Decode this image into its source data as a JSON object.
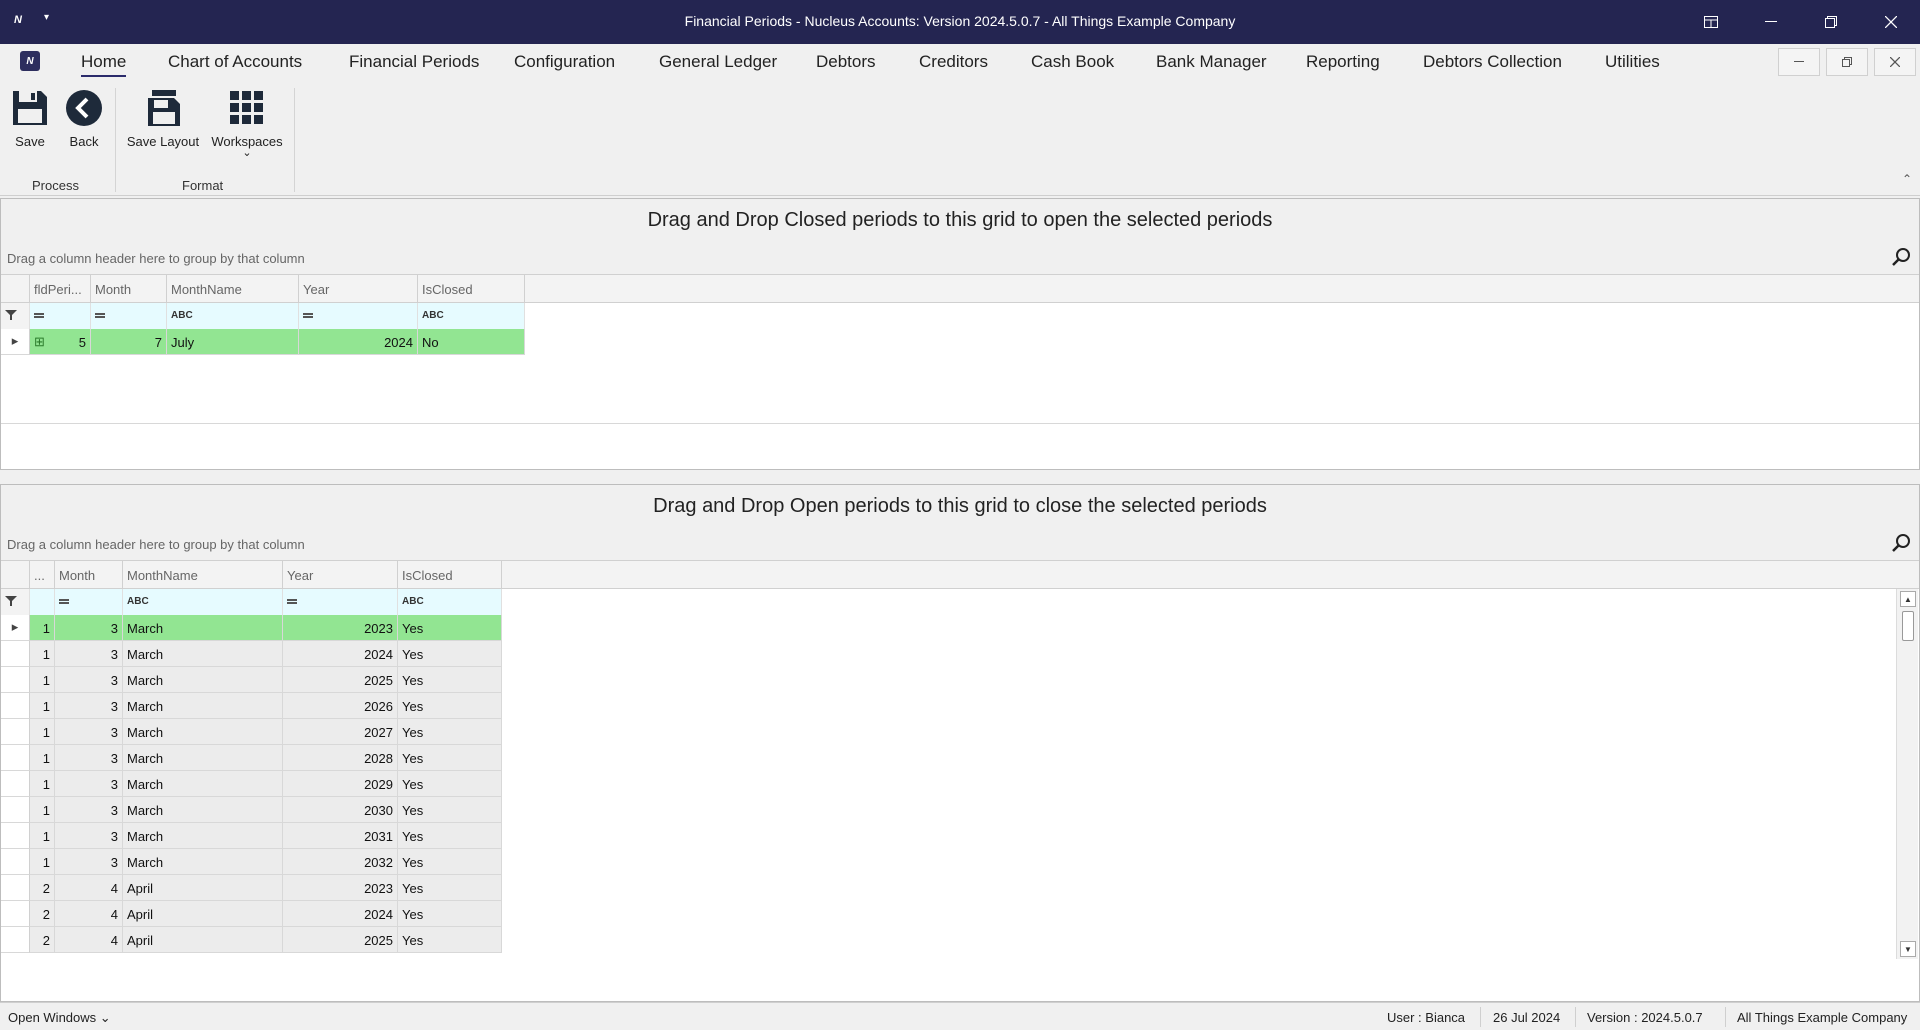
{
  "window": {
    "title": "Financial Periods - Nucleus Accounts: Version 2024.5.0.7 - All Things Example Company",
    "app_icon": "N",
    "quick_access_glyph": "▾"
  },
  "menu": {
    "tabs": [
      "Home",
      "Chart of Accounts",
      "Financial Periods",
      "Configuration",
      "General Ledger",
      "Debtors",
      "Creditors",
      "Cash Book",
      "Bank Manager",
      "Reporting",
      "Debtors Collection",
      "Utilities"
    ],
    "active_tab": "Home"
  },
  "ribbon": {
    "groups": [
      {
        "label": "Process",
        "buttons": [
          "Save",
          "Back"
        ]
      },
      {
        "label": "Format",
        "buttons": [
          "Save Layout",
          "Workspaces"
        ]
      }
    ],
    "workspaces_dropdown_glyph": "⌄",
    "collapse_glyph": "⌃"
  },
  "closed_panel": {
    "title": "Drag and Drop Closed periods to this grid to open the selected periods",
    "group_hint": "Drag a column header here to group by that column",
    "columns": [
      "fldPeri...",
      "Month",
      "MonthName",
      "Year",
      "IsClosed"
    ],
    "filter_glyphs": [
      "=",
      "=",
      "ABC",
      "=",
      "ABC"
    ],
    "rows": [
      {
        "expand": "⊞",
        "period": "5",
        "month": "7",
        "month_name": "July",
        "year": "2024",
        "is_closed": "No",
        "selected": true
      }
    ]
  },
  "open_panel": {
    "title": "Drag and Drop Open periods to this grid to close the selected periods",
    "group_hint": "Drag a column header here to group by that column",
    "columns": [
      "...",
      "Month",
      "MonthName",
      "Year",
      "IsClosed"
    ],
    "rows": [
      {
        "period": "1",
        "month": "3",
        "month_name": "March",
        "year": "2023",
        "is_closed": "Yes",
        "selected": true
      },
      {
        "period": "1",
        "month": "3",
        "month_name": "March",
        "year": "2024",
        "is_closed": "Yes"
      },
      {
        "period": "1",
        "month": "3",
        "month_name": "March",
        "year": "2025",
        "is_closed": "Yes"
      },
      {
        "period": "1",
        "month": "3",
        "month_name": "March",
        "year": "2026",
        "is_closed": "Yes"
      },
      {
        "period": "1",
        "month": "3",
        "month_name": "March",
        "year": "2027",
        "is_closed": "Yes"
      },
      {
        "period": "1",
        "month": "3",
        "month_name": "March",
        "year": "2028",
        "is_closed": "Yes"
      },
      {
        "period": "1",
        "month": "3",
        "month_name": "March",
        "year": "2029",
        "is_closed": "Yes"
      },
      {
        "period": "1",
        "month": "3",
        "month_name": "March",
        "year": "2030",
        "is_closed": "Yes"
      },
      {
        "period": "1",
        "month": "3",
        "month_name": "March",
        "year": "2031",
        "is_closed": "Yes"
      },
      {
        "period": "1",
        "month": "3",
        "month_name": "March",
        "year": "2032",
        "is_closed": "Yes"
      },
      {
        "period": "2",
        "month": "4",
        "month_name": "April",
        "year": "2023",
        "is_closed": "Yes"
      },
      {
        "period": "2",
        "month": "4",
        "month_name": "April",
        "year": "2024",
        "is_closed": "Yes"
      },
      {
        "period": "2",
        "month": "4",
        "month_name": "April",
        "year": "2025",
        "is_closed": "Yes"
      }
    ]
  },
  "status": {
    "open_windows": "Open Windows",
    "user": "User : Bianca",
    "date": "26 Jul 2024",
    "version": "Version : 2024.5.0.7",
    "company": "All Things Example Company"
  },
  "colors": {
    "titlebar": "#242551",
    "selected_row": "#92e592",
    "filter_row": "#e6fbff"
  }
}
